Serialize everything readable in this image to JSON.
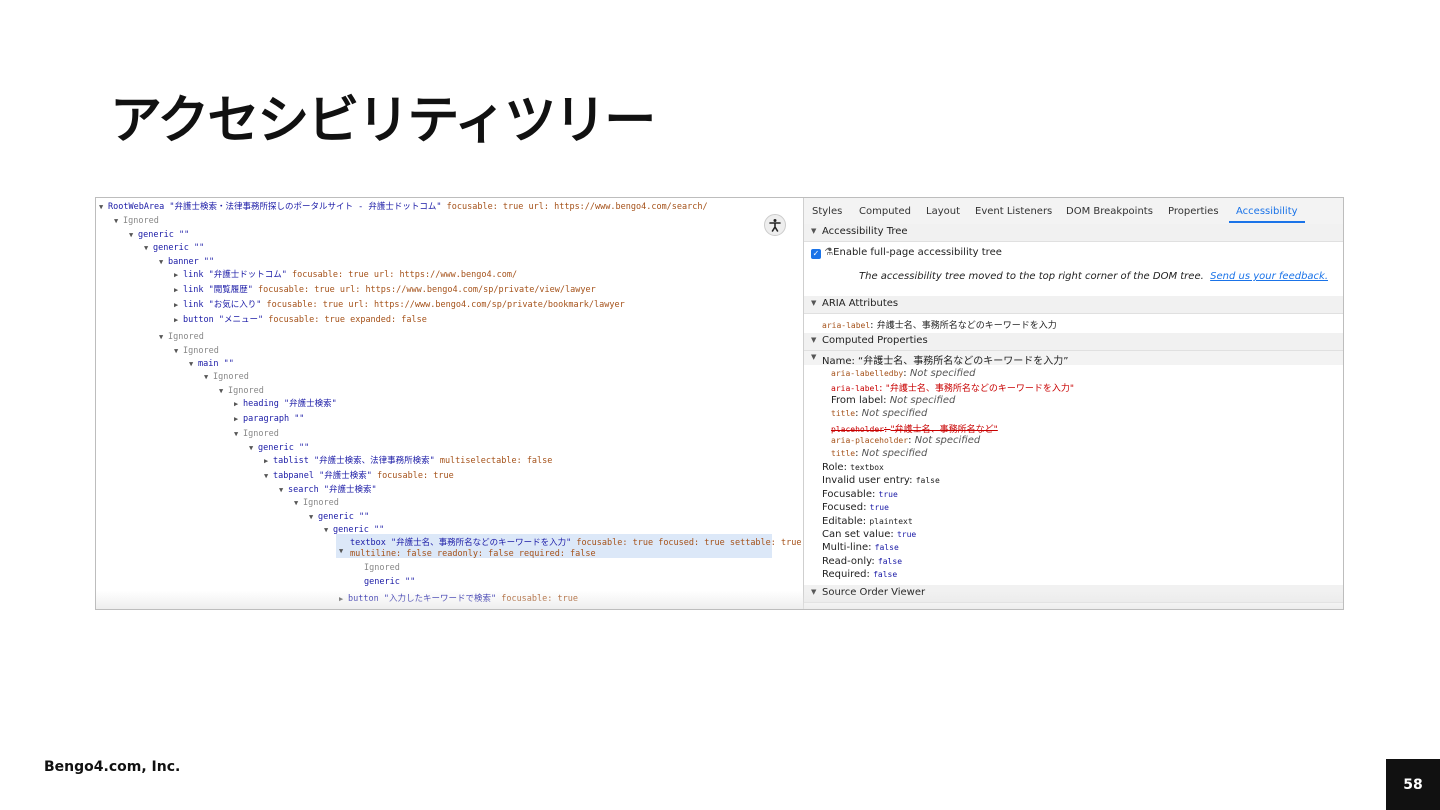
{
  "slide": {
    "title": "アクセシビリティツリー",
    "company": "Bengo4.com, Inc.",
    "page_number": "58"
  },
  "tree": {
    "rows": [
      {
        "role": "RootWebArea",
        "name": "\"弁護士検索・法律事務所探しのポータルサイト - 弁護士ドットコム\"",
        "props": " focusable: true url: https://www.bengo4.com/search/"
      },
      {
        "role": "Ignored",
        "name": "",
        "props": ""
      },
      {
        "role": "generic",
        "name": "\"\"",
        "props": ""
      },
      {
        "role": "generic",
        "name": "\"\"",
        "props": ""
      },
      {
        "role": "banner",
        "name": "\"\"",
        "props": ""
      },
      {
        "role": "link",
        "name": "\"弁護士ドットコム\"",
        "props": " focusable: true url: https://www.bengo4.com/"
      },
      {
        "role": "link",
        "name": "\"閲覧履歴\"",
        "props": " focusable: true url: https://www.bengo4.com/sp/private/view/lawyer"
      },
      {
        "role": "link",
        "name": "\"お気に入り\"",
        "props": " focusable: true url: https://www.bengo4.com/sp/private/bookmark/lawyer"
      },
      {
        "role": "button",
        "name": "\"メニュー\"",
        "props": " focusable: true expanded: false"
      },
      {
        "role": "Ignored",
        "name": "",
        "props": ""
      },
      {
        "role": "Ignored",
        "name": "",
        "props": ""
      },
      {
        "role": "main",
        "name": "\"\"",
        "props": ""
      },
      {
        "role": "Ignored",
        "name": "",
        "props": ""
      },
      {
        "role": "Ignored",
        "name": "",
        "props": ""
      },
      {
        "role": "heading",
        "name": "\"弁護士検索\"",
        "props": ""
      },
      {
        "role": "paragraph",
        "name": "\"\"",
        "props": ""
      },
      {
        "role": "Ignored",
        "name": "",
        "props": ""
      },
      {
        "role": "generic",
        "name": "\"\"",
        "props": ""
      },
      {
        "role": "tablist",
        "name": "\"弁護士検索、法律事務所検索\"",
        "props": " multiselectable: false"
      },
      {
        "role": "tabpanel",
        "name": "\"弁護士検索\"",
        "props": " focusable: true"
      },
      {
        "role": "search",
        "name": "\"弁護士検索\"",
        "props": ""
      },
      {
        "role": "Ignored",
        "name": "",
        "props": ""
      },
      {
        "role": "generic",
        "name": "\"\"",
        "props": ""
      },
      {
        "role": "generic",
        "name": "\"\"",
        "props": ""
      },
      {
        "role": "textbox",
        "name": "\"弁護士名、事務所名などのキーワードを入力\"",
        "props": " focusable: true focused: true settable: true"
      },
      {
        "role": "",
        "name": "",
        "props": "multiline: false readonly: false required: false"
      },
      {
        "role": "Ignored",
        "name": "",
        "props": ""
      },
      {
        "role": "generic",
        "name": "\"\"",
        "props": ""
      },
      {
        "role": "button",
        "name": "\"入力したキーワードで検索\"",
        "props": " focusable: true"
      }
    ]
  },
  "side": {
    "tabs": [
      "Styles",
      "Computed",
      "Layout",
      "Event Listeners",
      "DOM Breakpoints",
      "Properties",
      "Accessibility"
    ],
    "active_tab": "Accessibility",
    "sections": {
      "tree": "Accessibility Tree",
      "aria": "ARIA Attributes",
      "computed": "Computed Properties",
      "source": "Source Order Viewer"
    },
    "enable_label": "Enable full-page accessibility tree",
    "moved_notice": "The accessibility tree moved to the top right corner of the DOM tree.",
    "feedback_link": "Send us your feedback.",
    "aria_label_key": "aria-label",
    "aria_label_value": "弁護士名、事務所名などのキーワードを入力",
    "name_line": "Name: “弁護士名、事務所名などのキーワードを入力”",
    "name_sources": [
      {
        "key": "aria-labelledby",
        "value": "Not specified"
      },
      {
        "key": "aria-label",
        "value": "\"弁護士名、事務所名などのキーワードを入力\""
      },
      {
        "key": "From label",
        "value": "Not specified"
      },
      {
        "key": "title",
        "value": "Not specified"
      },
      {
        "key": "placeholder",
        "value": "\"弁護士名、事務所名など\""
      },
      {
        "key": "aria-placeholder",
        "value": "Not specified"
      },
      {
        "key": "title",
        "value": "Not specified"
      }
    ],
    "props": [
      {
        "key": "Role",
        "value": "textbox"
      },
      {
        "key": "Invalid user entry",
        "value": "false"
      },
      {
        "key": "Focusable",
        "value": "true"
      },
      {
        "key": "Focused",
        "value": "true"
      },
      {
        "key": "Editable",
        "value": "plaintext"
      },
      {
        "key": "Can set value",
        "value": "true"
      },
      {
        "key": "Multi-line",
        "value": "false"
      },
      {
        "key": "Read-only",
        "value": "false"
      },
      {
        "key": "Required",
        "value": "false"
      }
    ]
  }
}
